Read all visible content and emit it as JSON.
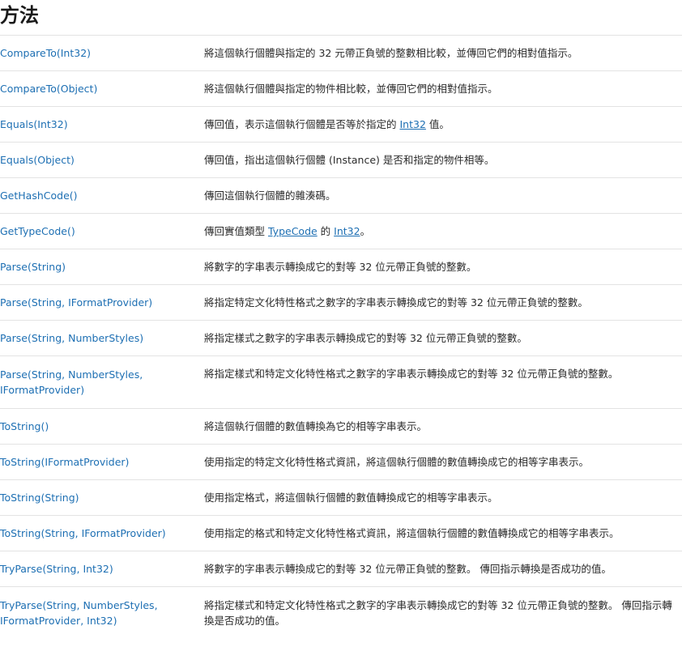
{
  "title": "方法",
  "rows": [
    {
      "name": "CompareTo(Int32)",
      "desc": "將這個執行個體與指定的 32 元帶正負號的整數相比較，並傳回它們的相對值指示。"
    },
    {
      "name": "CompareTo(Object)",
      "desc": "將這個執行個體與指定的物件相比較，並傳回它們的相對值指示。"
    },
    {
      "name": "Equals(Int32)",
      "desc_pre": "傳回值，表示這個執行個體是否等於指定的 ",
      "link1": "Int32",
      "desc_post": " 值。"
    },
    {
      "name": "Equals(Object)",
      "desc": "傳回值，指出這個執行個體 (Instance) 是否和指定的物件相等。"
    },
    {
      "name": "GetHashCode()",
      "desc": "傳回這個執行個體的雜湊碼。"
    },
    {
      "name": "GetTypeCode()",
      "desc_pre": "傳回實值類型 ",
      "link1": "TypeCode",
      "desc_mid": " 的 ",
      "link2": "Int32",
      "desc_post": "。"
    },
    {
      "name": "Parse(String)",
      "desc": "將數字的字串表示轉換成它的對等 32 位元帶正負號的整數。"
    },
    {
      "name": "Parse(String, IFormatProvider)",
      "desc": "將指定特定文化特性格式之數字的字串表示轉換成它的對等 32 位元帶正負號的整數。"
    },
    {
      "name": "Parse(String, NumberStyles)",
      "desc": "將指定樣式之數字的字串表示轉換成它的對等 32 位元帶正負號的整數。"
    },
    {
      "name": "Parse(String, NumberStyles, IFormatProvider)",
      "desc": "將指定樣式和特定文化特性格式之數字的字串表示轉換成它的對等 32 位元帶正負號的整數。"
    },
    {
      "name": "ToString()",
      "desc": "將這個執行個體的數值轉換為它的相等字串表示。"
    },
    {
      "name": "ToString(IFormatProvider)",
      "desc": "使用指定的特定文化特性格式資訊，將這個執行個體的數值轉換成它的相等字串表示。"
    },
    {
      "name": "ToString(String)",
      "desc": "使用指定格式，將這個執行個體的數值轉換成它的相等字串表示。"
    },
    {
      "name": "ToString(String, IFormatProvider)",
      "desc": "使用指定的格式和特定文化特性格式資訊，將這個執行個體的數值轉換成它的相等字串表示。"
    },
    {
      "name": "TryParse(String, Int32)",
      "desc": "將數字的字串表示轉換成它的對等 32 位元帶正負號的整數。 傳回指示轉換是否成功的值。"
    },
    {
      "name": "TryParse(String, NumberStyles, IFormatProvider, Int32)",
      "desc": "將指定樣式和特定文化特性格式之數字的字串表示轉換成它的對等 32 位元帶正負號的整數。 傳回指示轉換是否成功的值。"
    }
  ]
}
